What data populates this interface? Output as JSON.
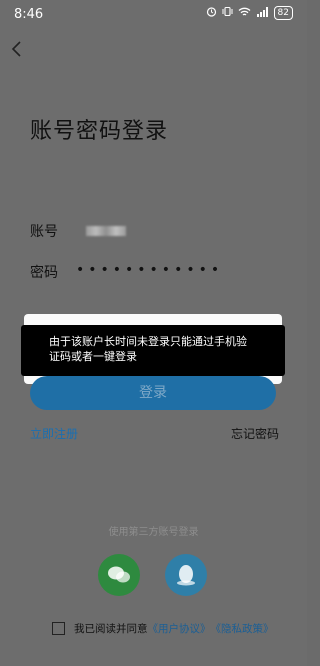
{
  "status": {
    "time": "8:46",
    "battery": "82"
  },
  "page": {
    "title": "账号密码登录"
  },
  "account": {
    "label": "账号"
  },
  "password": {
    "label": "密码",
    "masked": "••••••••••••"
  },
  "toast": {
    "line1": "由于该账户长时间未登录只能通过手机验",
    "line2": "证码或者一键登录"
  },
  "login_button": "登录",
  "links": {
    "register": "立即注册",
    "forgot": "忘记密码"
  },
  "third_party": {
    "label": "使用第三方账号登录"
  },
  "agreement": {
    "prefix": "我已阅读并同意",
    "user_agreement": "《用户协议》",
    "privacy": "《隐私政策》"
  },
  "colors": {
    "accent": "#1b6fb0",
    "toast_bg": "#000000",
    "overlay": "#6d6d6d"
  }
}
